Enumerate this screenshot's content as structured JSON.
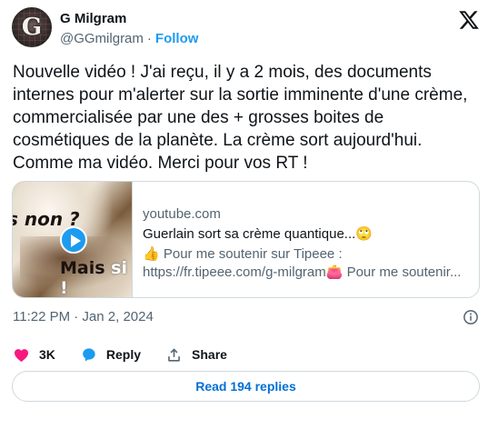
{
  "author": {
    "name": "G Milgram",
    "handle": "@GGmilgram",
    "separator": "·",
    "follow_label": "Follow",
    "avatar_letter": "G"
  },
  "tweet": {
    "text": "Nouvelle vidéo ! J'ai reçu, il y a 2 mois, des documents internes pour m'alerter sur la sortie imminente d'une crème, commercialisée par une des + grosses boites de cosmétiques de la planète. La crème sort aujourd'hui. Comme ma vidéo. Merci pour vos RT !"
  },
  "link_card": {
    "thumb_text_1": "s non ?",
    "thumb_text_2a": "Mais",
    "thumb_text_2b": " si !",
    "domain": "youtube.com",
    "title": "Guerlain sort sa crème quantique...🙄",
    "desc_line_1": "👍 Pour me soutenir sur Tipeee :",
    "desc_line_2": "https://fr.tipeee.com/g-milgram👛 Pour me soutenir..."
  },
  "meta": {
    "timestamp": "11:22 PM · Jan 2, 2024"
  },
  "actions": {
    "likes": "3K",
    "reply_label": "Reply",
    "share_label": "Share"
  },
  "replies": {
    "label": "Read 194 replies"
  },
  "colors": {
    "accent": "#1d9bf0",
    "like": "#f91880",
    "link_blue": "#006fd6",
    "secondary_text": "#536471",
    "border": "#cfd9de"
  },
  "icons": [
    "x-logo-icon",
    "play-icon",
    "info-icon",
    "heart-icon",
    "reply-bubble-icon",
    "share-icon"
  ]
}
